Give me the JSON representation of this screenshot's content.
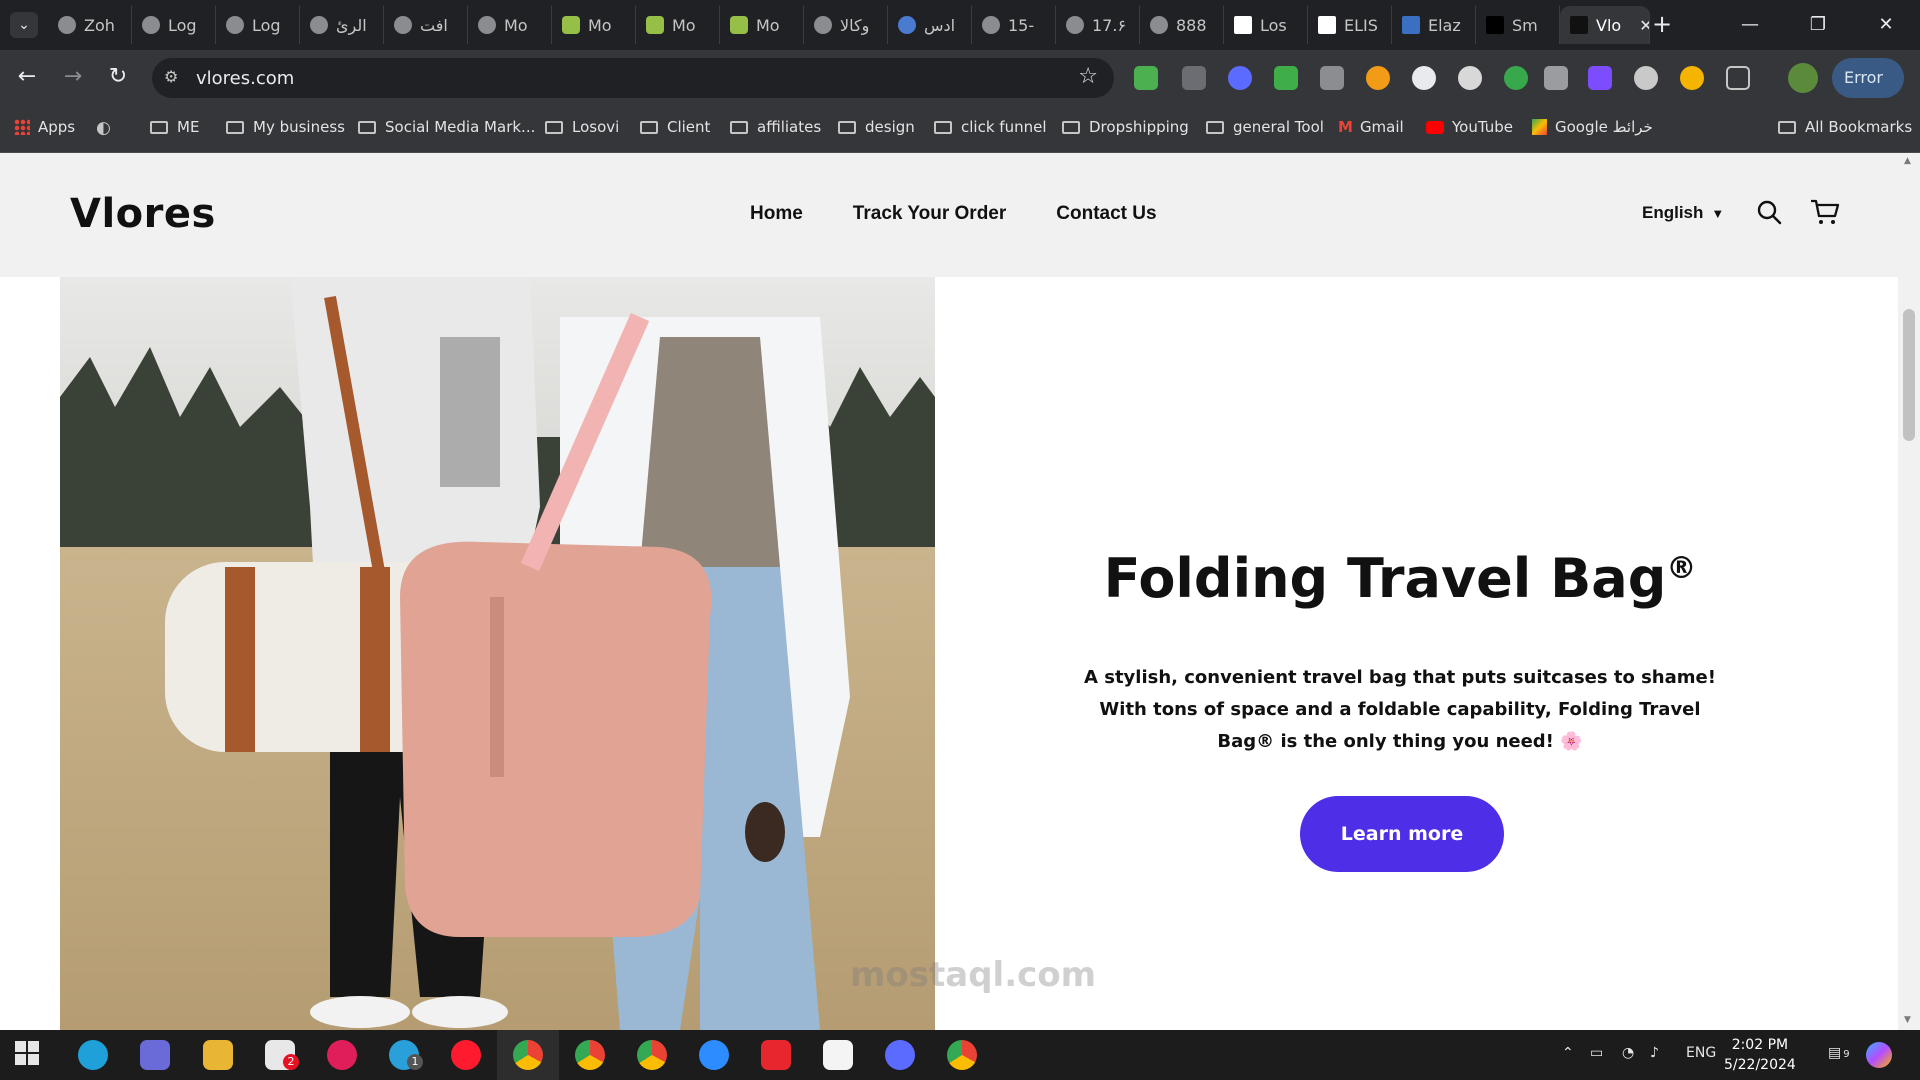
{
  "browser": {
    "tabs": [
      {
        "label": "Zoh"
      },
      {
        "label": "Log"
      },
      {
        "label": "Log"
      },
      {
        "label": "الرئ"
      },
      {
        "label": "افت"
      },
      {
        "label": "Mo"
      },
      {
        "label": "Mo"
      },
      {
        "label": "Mo"
      },
      {
        "label": "Mo"
      },
      {
        "label": "وكالا"
      },
      {
        "label": "ادس"
      },
      {
        "label": "15-"
      },
      {
        "label": "17.۶"
      },
      {
        "label": "888"
      },
      {
        "label": "Los"
      },
      {
        "label": "ELIS"
      },
      {
        "label": "Elaz"
      },
      {
        "label": "Sm"
      },
      {
        "label": "Vlo"
      }
    ],
    "address": "vlores.com",
    "error_button": "Error",
    "bookmarks": [
      {
        "label": "Apps"
      },
      {
        "label": "ME"
      },
      {
        "label": "My business"
      },
      {
        "label": "Social Media Mark..."
      },
      {
        "label": "Losovi"
      },
      {
        "label": "Client"
      },
      {
        "label": "affiliates"
      },
      {
        "label": "design"
      },
      {
        "label": "click funnel"
      },
      {
        "label": "Dropshipping"
      },
      {
        "label": "general Tool"
      },
      {
        "label": "Gmail"
      },
      {
        "label": "YouTube"
      },
      {
        "label": "Google خرائط"
      },
      {
        "label": "All Bookmarks"
      }
    ]
  },
  "site": {
    "logo": "Vlores",
    "nav": [
      {
        "label": "Home"
      },
      {
        "label": "Track Your Order"
      },
      {
        "label": "Contact Us"
      }
    ],
    "language": "English"
  },
  "hero": {
    "title": "Folding Travel Bag",
    "title_mark": "®",
    "description": "A stylish, convenient travel bag that puts suitcases to shame! With tons of space and a foldable capability, Folding Travel Bag® is the only thing you need! 🌸",
    "cta": "Learn more"
  },
  "watermark": "mostaql.com",
  "taskbar": {
    "language": "ENG",
    "time": "2:02 PM",
    "date": "5/22/2024",
    "mail_badge": "2",
    "telegram_badge": "1",
    "notif_badge": "9"
  }
}
